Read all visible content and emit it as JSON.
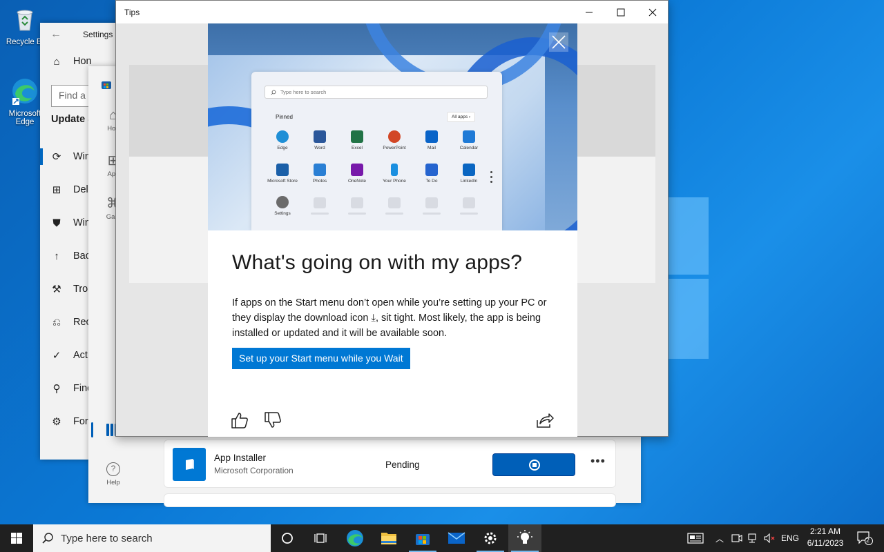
{
  "desktop": {
    "icons": [
      {
        "label": "Recycle Bi",
        "name": "recycle-bin"
      },
      {
        "label": "Microsoft Edge",
        "name": "microsoft-edge"
      }
    ]
  },
  "settings": {
    "title": "Settings",
    "home_label": "Hon",
    "find_placeholder": "Find a",
    "section": "Update &",
    "items": [
      {
        "label": "Win",
        "icon": "sync-icon"
      },
      {
        "label": "Deli",
        "icon": "delivery-optimization-icon"
      },
      {
        "label": "Win",
        "icon": "shield-icon"
      },
      {
        "label": "Back",
        "icon": "backup-arrow-icon"
      },
      {
        "label": "Trou",
        "icon": "wrench-icon"
      },
      {
        "label": "Reco",
        "icon": "recovery-icon"
      },
      {
        "label": "Acti",
        "icon": "activation-check-icon"
      },
      {
        "label": "Find",
        "icon": "find-device-icon"
      },
      {
        "label": "For",
        "icon": "developer-icon"
      }
    ]
  },
  "store": {
    "nav": [
      {
        "label": "Hon",
        "icon": "home-icon"
      },
      {
        "label": "App",
        "icon": "apps-icon"
      },
      {
        "label": "Gam",
        "icon": "gaming-icon"
      }
    ],
    "help_label": "Help",
    "downloads": [
      {
        "name": "App Installer",
        "publisher": "Microsoft Corporation",
        "status": "Pending"
      }
    ]
  },
  "tips": {
    "window_title": "Tips",
    "card": {
      "headline": "What's going on with my apps?",
      "body_part1": "If apps on the Start menu don’t open while you’re setting up your PC or they display the download icon ",
      "download_glyph": "⤓",
      "body_part2": ", sit tight. Most likely, the app is being installed or updated and it will be available soon.",
      "cta": "Set up your Start menu while you Wait"
    },
    "start_menu_preview": {
      "search_placeholder": "Type here to search",
      "pinned_label": "Pinned",
      "all_apps_label": "All apps  ›",
      "apps": [
        {
          "label": "Edge",
          "color": "#1f8fd6"
        },
        {
          "label": "Word",
          "color": "#2b579a"
        },
        {
          "label": "Excel",
          "color": "#217346"
        },
        {
          "label": "PowerPoint",
          "color": "#d24726"
        },
        {
          "label": "Mail",
          "color": "#0a64c8"
        },
        {
          "label": "Calendar",
          "color": "#1f7ad6"
        },
        {
          "label": "Microsoft Store",
          "color": "#1a5fa8"
        },
        {
          "label": "Photos",
          "color": "#2a7fd4"
        },
        {
          "label": "OneNote",
          "color": "#7719aa"
        },
        {
          "label": "Your Phone",
          "color": "#1a8fe0"
        },
        {
          "label": "To Do",
          "color": "#2564cf"
        },
        {
          "label": "LinkedIn",
          "color": "#0a66c2"
        },
        {
          "label": "Settings",
          "color": "#6b6b6b"
        }
      ]
    }
  },
  "taskbar": {
    "search_placeholder": "Type here to search",
    "language": "ENG",
    "time": "2:21 AM",
    "date": "6/11/2023",
    "notification_count": "2"
  }
}
